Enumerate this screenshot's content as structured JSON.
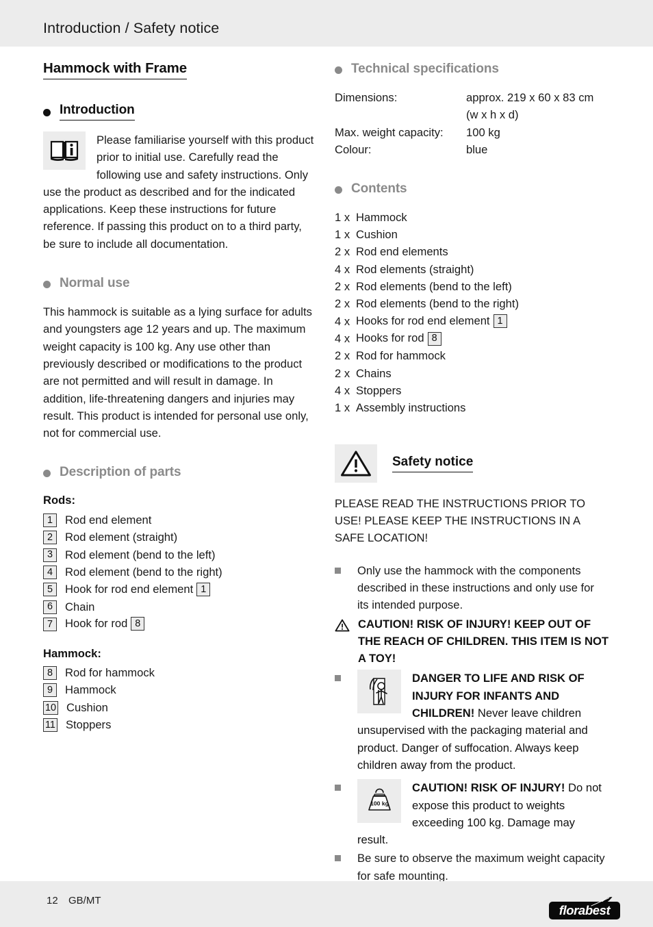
{
  "header": {
    "title": "Introduction / Safety notice"
  },
  "product": {
    "title": "Hammock with Frame"
  },
  "left_column": {
    "introduction": {
      "heading": "Introduction",
      "icon": "info-book-icon",
      "paragraph": "Please familiarise yourself with this product prior to initial use. Carefully read the following use and safety instructions. Only use the product as described and for the indicated applications. Keep these instructions for future reference. If passing this product on to a third party, be sure to include all documentation."
    },
    "normal_use": {
      "heading": "Normal use",
      "paragraph": "This hammock is suitable as a lying surface for adults and youngsters age 12 years and up. The maximum weight capacity is 100 kg. Any use other than previously described or modifications to the product are not permitted and will result in damage. In addition, life-threatening dangers and injuries may result. This product is intended for personal use only, not for commercial use."
    },
    "description_of_parts": {
      "heading": "Description of parts",
      "rods_label": "Rods:",
      "rods": [
        {
          "num": "1",
          "label": "Rod end element",
          "ref": null
        },
        {
          "num": "2",
          "label": "Rod element (straight)",
          "ref": null
        },
        {
          "num": "3",
          "label": "Rod element (bend to the left)",
          "ref": null
        },
        {
          "num": "4",
          "label": "Rod element (bend to the right)",
          "ref": null
        },
        {
          "num": "5",
          "label": "Hook for rod end element",
          "ref": "1"
        },
        {
          "num": "6",
          "label": "Chain",
          "ref": null
        },
        {
          "num": "7",
          "label": "Hook for rod",
          "ref": "8"
        }
      ],
      "hammock_label": "Hammock:",
      "hammock": [
        {
          "num": "8",
          "label": "Rod for hammock",
          "ref": null
        },
        {
          "num": "9",
          "label": "Hammock",
          "ref": null
        },
        {
          "num": "10",
          "label": "Cushion",
          "ref": null
        },
        {
          "num": "11",
          "label": "Stoppers",
          "ref": null
        }
      ]
    }
  },
  "right_column": {
    "technical_specifications": {
      "heading": "Technical specifications",
      "rows": [
        {
          "key": "Dimensions:",
          "value": "approx. 219 x 60 x 83 cm\n(w x h x d)"
        },
        {
          "key": "Max. weight capacity:",
          "value": "100 kg"
        },
        {
          "key": "Colour:",
          "value": "blue"
        }
      ]
    },
    "contents": {
      "heading": "Contents",
      "items": [
        {
          "qty": "1 x",
          "label": "Hammock",
          "ref": null
        },
        {
          "qty": "1 x",
          "label": "Cushion",
          "ref": null
        },
        {
          "qty": "2 x",
          "label": "Rod end elements",
          "ref": null
        },
        {
          "qty": "4 x",
          "label": "Rod elements (straight)",
          "ref": null
        },
        {
          "qty": "2 x",
          "label": "Rod elements (bend to the left)",
          "ref": null
        },
        {
          "qty": "2 x",
          "label": "Rod elements (bend to the right)",
          "ref": null
        },
        {
          "qty": "4 x",
          "label": "Hooks for rod end element",
          "ref": "1"
        },
        {
          "qty": "4 x",
          "label": "Hooks for rod",
          "ref": "8"
        },
        {
          "qty": "2 x",
          "label": "Rod for hammock",
          "ref": null
        },
        {
          "qty": "2 x",
          "label": "Chains",
          "ref": null
        },
        {
          "qty": "4 x",
          "label": "Stoppers",
          "ref": null
        },
        {
          "qty": "1 x",
          "label": "Assembly instructions",
          "ref": null
        }
      ]
    },
    "safety_notice": {
      "heading": "Safety notice",
      "icon": "warning-triangle-icon",
      "intro": "PLEASE READ THE INSTRUCTIONS PRIOR TO USE! PLEASE KEEP THE INSTRUCTIONS IN A SAFE LOCATION!",
      "bullet_1": "Only use the hammock with the components described in these instructions and only use for its intended purpose.",
      "caution_children": "CAUTION! RISK OF INJURY! KEEP OUT OF THE REACH OF CHILDREN. THIS ITEM IS NOT A TOY!",
      "danger_infants_bold": "DANGER TO LIFE AND RISK OF INJURY FOR INFANTS AND CHILDREN!",
      "danger_infants_rest": " Never leave children unsupervised with the packaging material and product. Danger of suffocation. Always keep children away from the product.",
      "caution_weight_bold": "CAUTION! RISK OF INJURY!",
      "caution_weight_rest": " Do not expose this product to weights exceeding 100 kg. Damage may result.",
      "bullet_last": "Be sure to observe the maximum weight capacity for safe mounting.",
      "weight_icon_label": "100 kg"
    }
  },
  "footer": {
    "page_number": "12",
    "language": "GB/MT",
    "brand": "florabest"
  },
  "colors": {
    "band": "#ececec",
    "heading_gray": "#8a8a8a",
    "text": "#1a1a1a"
  }
}
